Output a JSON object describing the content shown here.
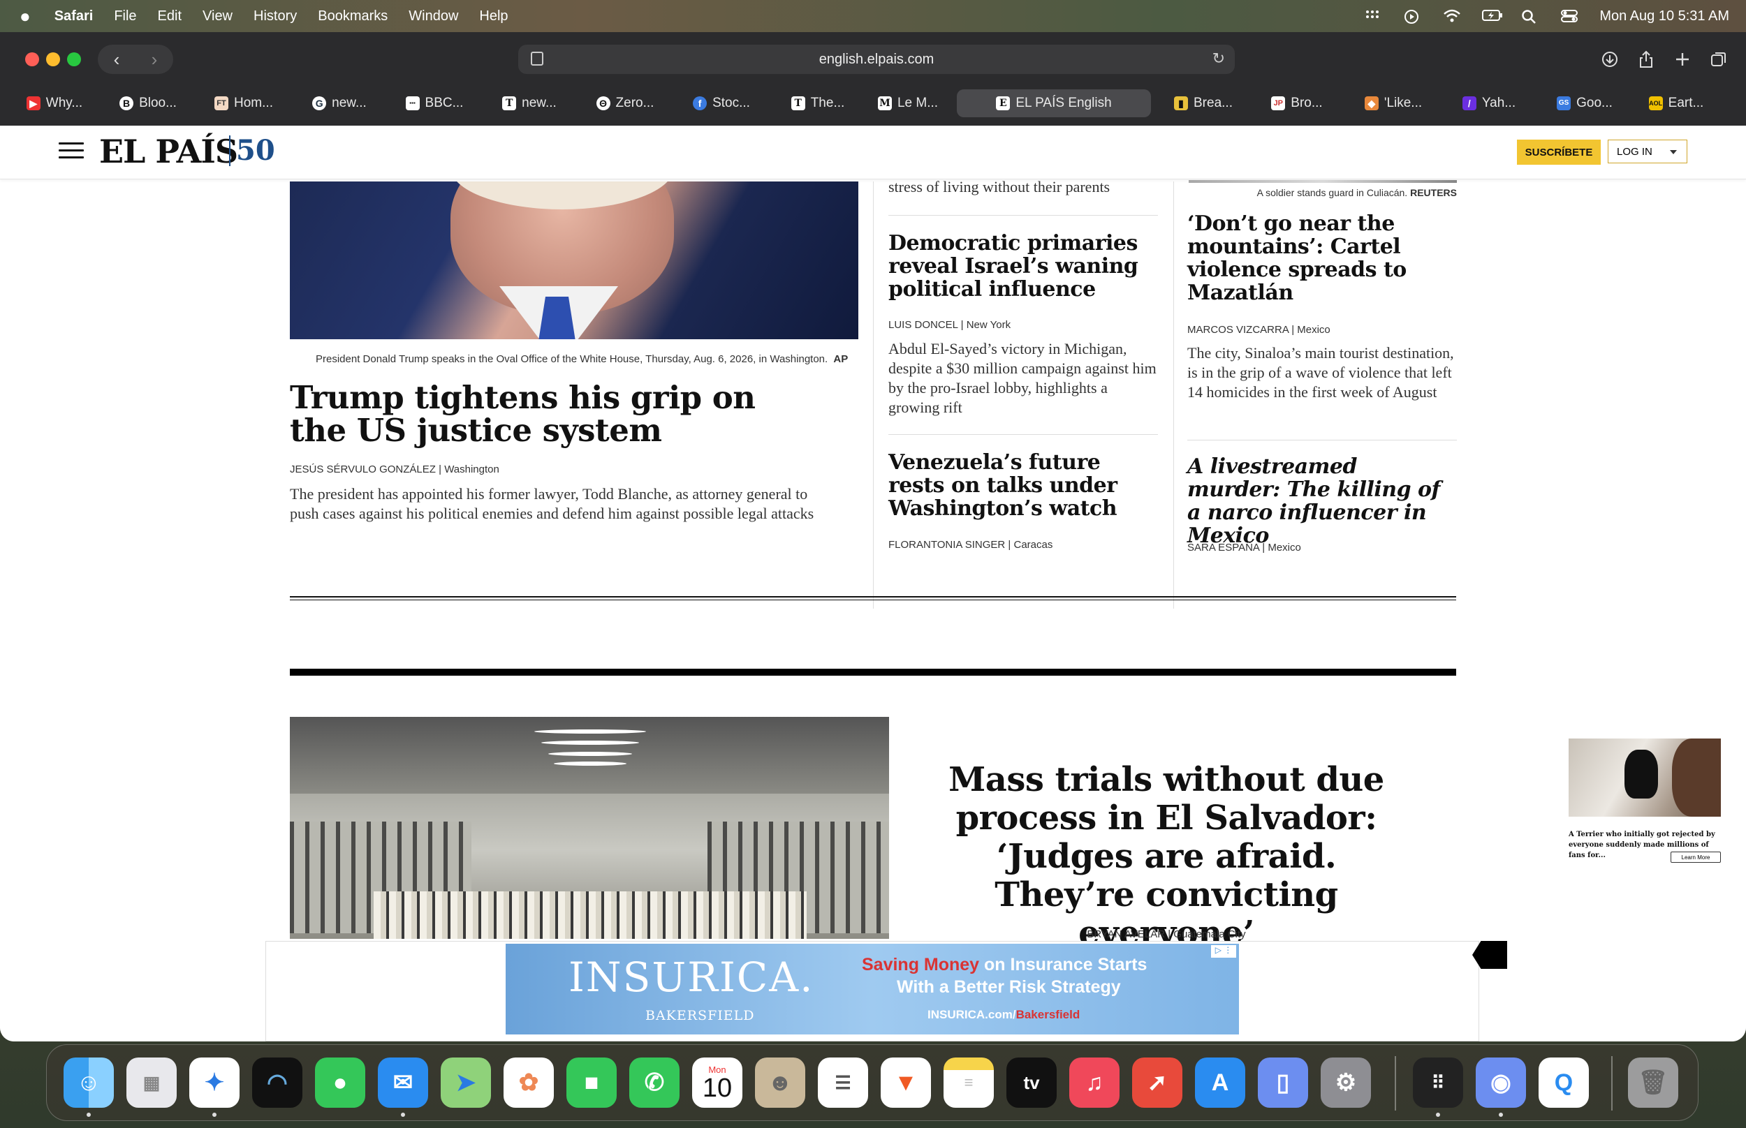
{
  "menubar": {
    "apple": "",
    "app_name": "Safari",
    "menus": [
      "File",
      "Edit",
      "View",
      "History",
      "Bookmarks",
      "Window",
      "Help"
    ],
    "datetime": "Mon Aug 10  5:31 AM"
  },
  "safari": {
    "url": "english.elpais.com",
    "favorites": [
      {
        "label": "Why...",
        "icon": "youtube-icon",
        "color": "#e33"
      },
      {
        "label": "Bloo...",
        "icon": "B",
        "color": "#222"
      },
      {
        "label": "Hom...",
        "icon": "FT",
        "color": "#f3d9c4"
      },
      {
        "label": "new...",
        "icon": "G",
        "color": "#234"
      },
      {
        "label": "BBC...",
        "icon": "BBC",
        "color": "#111"
      },
      {
        "label": "new...",
        "icon": "T",
        "color": "#111"
      },
      {
        "label": "Zero...",
        "icon": "Θ",
        "color": "#111"
      },
      {
        "label": "Stoc...",
        "icon": "f",
        "color": "#3b7be0"
      },
      {
        "label": "The...",
        "icon": "𝕿",
        "color": "#111"
      },
      {
        "label": "Le M...",
        "icon": "M",
        "color": "#111"
      },
      {
        "label": "EL PAÍS English",
        "icon": "E",
        "color": "#111",
        "active": true
      },
      {
        "label": "Brea...",
        "icon": "▮",
        "color": "#e8c13b"
      },
      {
        "label": "Bro...",
        "icon": "JP",
        "color": "#c33"
      },
      {
        "label": "'Like...",
        "icon": "◆",
        "color": "#e8883b"
      },
      {
        "label": "Yah...",
        "icon": "/",
        "color": "#6b2fe0"
      },
      {
        "label": "Goo...",
        "icon": "GS",
        "color": "#3b7be0"
      },
      {
        "label": "Eart...",
        "icon": "AOL",
        "color": "#f0c000"
      }
    ]
  },
  "site": {
    "logo": "EL PAÍS",
    "logo_anniversary": "50",
    "subscribe_label": "SUSCRÍBETE",
    "login_label": "LOG IN"
  },
  "articles": {
    "lead": {
      "caption": "President Donald Trump speaks in the Oval Office of the White House, Thursday, Aug. 6, 2026, in Washington.",
      "caption_credit": "AP",
      "headline": "Trump tightens his grip on the US justice system",
      "author": "JESÚS SÉRVULO GONZÁLEZ",
      "location": "Washington",
      "summary": "The president has appointed his former lawyer, Todd Blanche, as attorney general to push cases against his political enemies and defend him against possible legal attacks"
    },
    "mid_top_fragment": "stress of living without their parents",
    "mid1": {
      "headline": "Democratic primaries reveal Israel’s waning political influence",
      "author": "LUIS DONCEL",
      "location": "New York",
      "summary": "Abdul El-Sayed’s victory in Michigan, despite a $30 million campaign against him by the pro-Israel lobby, highlights a growing rift"
    },
    "mid2": {
      "headline": "Venezuela’s future rests on talks under Washington’s watch",
      "author": "FLORANTONIA SINGER",
      "location": "Caracas"
    },
    "right_caption": "A soldier stands guard in Culiacán.",
    "right_caption_credit": "REUTERS",
    "right1": {
      "headline": "‘Don’t go near the mountains’: Cartel violence spreads to Mazatlán",
      "author": "MARCOS VIZCARRA",
      "location": "Mexico",
      "summary": "The city, Sinaloa’s main tourist destination, is in the grip of a wave of violence that left 14 homicides in the first week of August"
    },
    "right2": {
      "headline": "A livestreamed murder: The killing of a narco influencer in Mexico",
      "author": "SARA ESPAÑA",
      "location": "Mexico"
    },
    "feature": {
      "headline": "Mass trials without due process in El Salvador: ‘Judges are afraid. They’re convicting everyone’",
      "author": "BRYAN AVELAR",
      "location": "Guatemala City"
    }
  },
  "ads": {
    "bottom": {
      "brand": "INSURICA.",
      "location": "BAKERSFIELD",
      "line1_highlight": "Saving Money",
      "line1_rest": " on Insurance Starts",
      "line2": "With a Better Risk Strategy",
      "url_prefix": "INSURICA.com/",
      "url_highlight": "Bakersfield",
      "adchoices": "▷ ⋮"
    },
    "side": {
      "text": "A Terrier who initially got rejected by everyone suddenly made millions of fans for...",
      "cta": "Learn More"
    }
  },
  "dock": {
    "calendar_month": "Mon",
    "calendar_day": "10",
    "tv_label": "tv",
    "apps": [
      "finder-icon",
      "launchpad-icon",
      "safari-icon",
      "arc-icon",
      "messages-icon",
      "mail-icon",
      "maps-icon",
      "photos-icon",
      "facetime-icon",
      "phone-icon",
      "calendar-icon",
      "contacts-icon",
      "reminders-icon",
      "brave-icon",
      "notes-icon",
      "appletv-icon",
      "music-icon",
      "rocket-icon",
      "appstore-icon",
      "iphone-mirroring-icon",
      "settings-icon",
      "launcher-icon",
      "server-icon",
      "quicktime-icon",
      "trash-icon"
    ]
  }
}
